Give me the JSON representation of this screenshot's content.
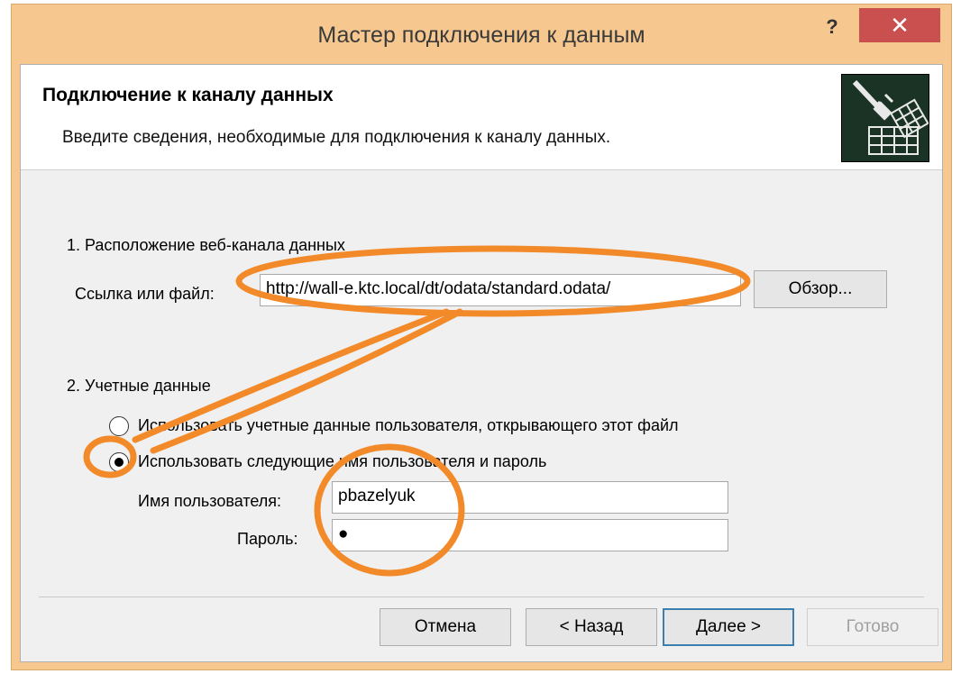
{
  "window": {
    "title": "Мастер подключения к данным",
    "help_label": "?",
    "close_label": "✕"
  },
  "header": {
    "title": "Подключение к каналу данных",
    "subtitle": "Введите сведения, необходимые для подключения к каналу данных."
  },
  "location": {
    "section_label": "1. Расположение веб-канала данных",
    "field_label": "Ссылка или файл:",
    "value": "http://wall-e.ktc.local/dt/odata/standard.odata/",
    "browse_label": "Обзор..."
  },
  "credentials": {
    "section_label": "2. Учетные данные",
    "option_current_user": "Использовать учетные данные пользователя, открывающего этот файл",
    "option_specific_user": "Использовать следующие имя пользователя и пароль",
    "selected": "specific_user",
    "username_label": "Имя пользователя:",
    "username_value": "pbazelyuk",
    "password_label": "Пароль:",
    "password_value": "●"
  },
  "footer": {
    "cancel_label": "Отмена",
    "back_label": "< Назад",
    "next_label": "Далее >",
    "finish_label": "Готово"
  },
  "colors": {
    "frame": "#f6c890",
    "close": "#c9504f",
    "annotation": "#f28a2a"
  },
  "icons": [
    "help-icon",
    "close-icon",
    "data-connection-wizard-icon"
  ]
}
